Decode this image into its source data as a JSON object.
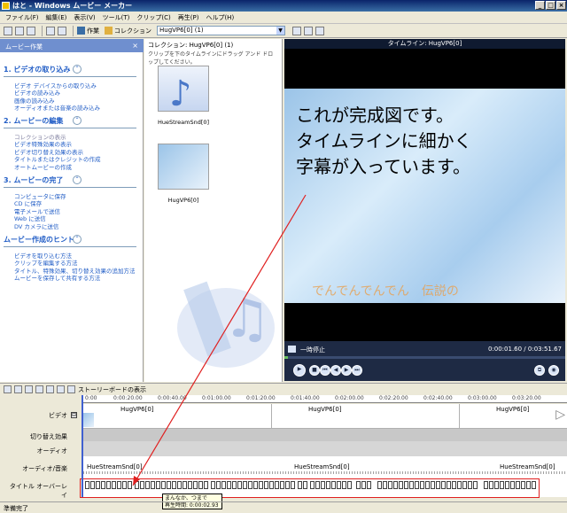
{
  "window": {
    "title": "はと - Windows ムービー メーカー"
  },
  "menu": [
    "ファイル(F)",
    "編集(E)",
    "表示(V)",
    "ツール(T)",
    "クリップ(C)",
    "再生(P)",
    "ヘルプ(H)"
  ],
  "toolbar": {
    "tasks_label": "作業",
    "collections_label": "コレクション",
    "collection_select": "HugVP6[0] (1)"
  },
  "taskpane": {
    "header": "ムービー作業",
    "sections": [
      {
        "title": "1. ビデオの取り込み",
        "items": [
          "ビデオ デバイスからの取り込み",
          "ビデオの読み込み",
          "画像の読み込み",
          "オーディオまたは音楽の読み込み"
        ]
      },
      {
        "title": "2. ムービーの編集",
        "items": [
          "コレクションの表示",
          "ビデオ特殊効果の表示",
          "ビデオ切り替え効果の表示",
          "タイトルまたはクレジットの作成",
          "オートムービーの作成"
        ]
      },
      {
        "title": "3. ムービーの完了",
        "items": [
          "コンピュータに保存",
          "CD に保存",
          "電子メールで送信",
          "Web に送信",
          "DV カメラに送信"
        ]
      },
      {
        "title": "ムービー作成のヒント",
        "items": [
          "ビデオを取り込む方法",
          "クリップを編集する方法",
          "タイトル、特殊効果、切り替え効果の追加方法",
          "ムービーを保存して共有する方法"
        ]
      }
    ]
  },
  "collection": {
    "header": "コレクション: HugVP6[0] (1)",
    "subheader": "クリップを下のタイムラインにドラッグ アンド ドロップしてください。",
    "clips": [
      "HueStreamSnd[0]",
      "HugVP6[0]"
    ]
  },
  "monitor": {
    "title": "タイムライン: HugVP6[0]",
    "overlay_text": "これが完成図です。\nタイムラインに細かく\n字幕が入っています。",
    "subtitle_text": "でんでんでんでん　伝説の",
    "status": "一時停止",
    "time": "0:00:01.60 / 0:03:51.67"
  },
  "timeline": {
    "storyboard_label": "ストーリーボードの表示",
    "ruler": [
      "0:00",
      "0:00:20.00",
      "0:00:40.00",
      "0:01:00.00",
      "0:01:20.00",
      "0:01:40.00",
      "0:02:00.00",
      "0:02:20.00",
      "0:02:40.00",
      "0:03:00.00",
      "0:03:20.00"
    ],
    "tracks": {
      "video": "ビデオ",
      "transition": "切り替え効果",
      "audio": "オーディオ",
      "music": "オーディオ/音楽",
      "title": "タイトル オーバーレイ"
    },
    "video_clips": [
      "HugVP6[0]",
      "HugVP6[0]",
      "HugVP6[0]"
    ],
    "music_clips": [
      "HueStreamSnd[0]",
      "HueStreamSnd[0]",
      "HueStreamSnd[0]"
    ],
    "tooltip": {
      "line1": "まんなか、つまで",
      "line2": "再生時間: 0:00:02.93"
    }
  },
  "statusbar": "準備完了",
  "colors": {
    "accent": "#215dc6",
    "highlight": "#e02020"
  }
}
